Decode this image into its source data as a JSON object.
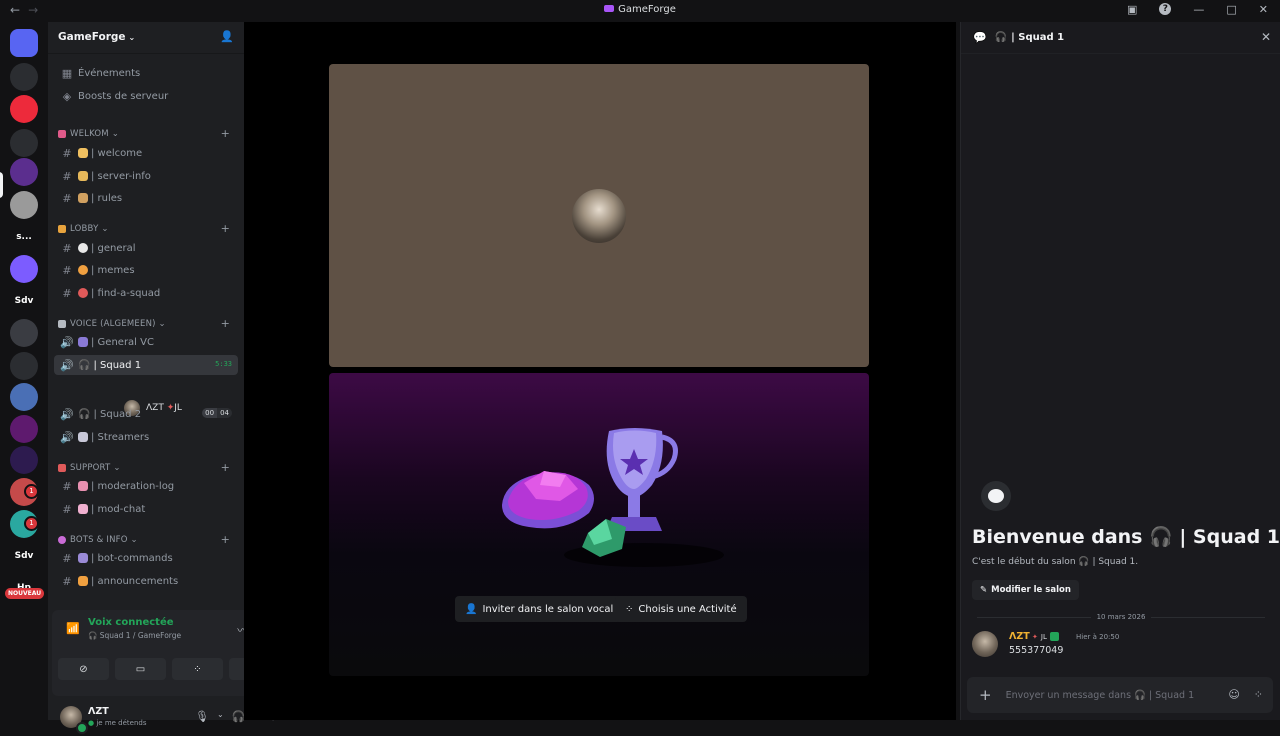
{
  "window": {
    "title": "GameForge"
  },
  "rail": {
    "servers": [
      {
        "label": "",
        "color": "#5865f2"
      },
      {
        "label": "",
        "color": "#2b2d31"
      },
      {
        "label": "",
        "color": "#ed2a3b"
      },
      {
        "label": "",
        "color": "#2b2d31"
      },
      {
        "label": "",
        "color": "#5b2e8e"
      },
      {
        "label": "",
        "color": "#9a9a9a"
      },
      {
        "label": "s...",
        "color": "#121214"
      },
      {
        "label": "",
        "color": "#7c5cff"
      },
      {
        "label": "Sdv",
        "color": "#121214"
      },
      {
        "label": "",
        "color": "#3a3c42"
      },
      {
        "label": "",
        "color": "#2b2d31"
      },
      {
        "label": "",
        "color": "#4a6fb5"
      },
      {
        "label": "",
        "color": "#5e1a6e"
      },
      {
        "label": "",
        "color": "#2d1b4f"
      },
      {
        "label": "",
        "color": "#c54a4a"
      },
      {
        "label": "",
        "color": "#2aa8a0"
      },
      {
        "label": "Sdv",
        "color": "#121214"
      },
      {
        "label": "Hp",
        "color": "#121214"
      }
    ],
    "badges": [
      "1",
      "1"
    ],
    "new_label": "NOUVEAU"
  },
  "sidebar": {
    "guild_name": "GameForge",
    "top_items": [
      "Événements",
      "Boosts de serveur"
    ],
    "categories": [
      {
        "name": "WELKOM",
        "color": "#e05a8a"
      },
      {
        "name": "LOBBY",
        "color": "#e8a33d"
      },
      {
        "name": "VOICE (ALGEMEEN)",
        "color": "#b5bac1"
      },
      {
        "name": "SUPPORT",
        "color": "#e05a5a"
      },
      {
        "name": "BOTS & INFO",
        "color": "#c96bd6"
      }
    ],
    "channels": {
      "welcome": "| welcome",
      "server_info": "| server-info",
      "rules": "| rules",
      "general": "| general",
      "memes": "| memes",
      "find_a_squad": "| find-a-squad",
      "general_vc": "| General VC",
      "squad1": "| Squad 1",
      "squad1_time": "5:33",
      "squad2": "| Squad 2",
      "squad2_limit": [
        "00",
        "04"
      ],
      "streamers": "| Streamers",
      "moderation_log": "| moderation-log",
      "mod_chat": "| mod-chat",
      "bot_commands": "| bot-commands",
      "announcements": "| announcements"
    },
    "voice_user": {
      "name": "ΛΖΤ",
      "tag": "JL"
    }
  },
  "voice_panel": {
    "status": "Voix connectée",
    "location": "Squad 1 / GameForge"
  },
  "user_panel": {
    "name": "ΛΖΤ",
    "status_text": "je me détends"
  },
  "stage": {
    "invite_label": "Inviter dans le salon vocal",
    "activity_label": "Choisis une Activité"
  },
  "chat": {
    "header": "| Squad 1",
    "welcome_title": "Bienvenue dans 🎧 | Squad 1 !",
    "welcome_sub": "C'est le début du salon 🎧 | Squad 1.",
    "edit_label": "Modifier le salon",
    "date": "10 mars 2026",
    "message": {
      "author": "ΛΖΤ",
      "tag": "JL",
      "time": "Hier à 20:50",
      "text": "555377049"
    },
    "composer_placeholder": "Envoyer un message dans 🎧 | Squad 1"
  },
  "colors": {
    "accent": "#5865f2",
    "online": "#23a559",
    "author": "#f0b232"
  }
}
